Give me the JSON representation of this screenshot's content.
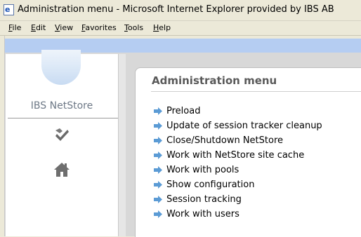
{
  "window": {
    "title": "Administration menu - Microsoft Internet Explorer provided by IBS AB",
    "icon": "ie-page-icon"
  },
  "menubar": {
    "items": [
      {
        "label_first": "F",
        "label_rest": "ile"
      },
      {
        "label_first": "E",
        "label_rest": "dit"
      },
      {
        "label_first": "V",
        "label_rest": "iew"
      },
      {
        "label_first": "F",
        "label_rest": "avorites"
      },
      {
        "label_first": "T",
        "label_rest": "ools"
      },
      {
        "label_first": "H",
        "label_rest": "elp"
      }
    ]
  },
  "sidebar": {
    "logo_text": "IBS NetStore",
    "icons": [
      "checkmark-tools-icon",
      "home-icon"
    ]
  },
  "content": {
    "title": "Administration menu",
    "links": [
      "Preload",
      "Update of session tracker cleanup",
      "Close/Shutdown NetStore",
      "Work with NetStore site cache",
      "Work with pools",
      "Show configuration",
      "Session tracking",
      "Work with users"
    ]
  },
  "colors": {
    "link_arrow": "#5b9bd5",
    "header_band": "#b5cdf2",
    "title_text": "#5a5a5a"
  }
}
